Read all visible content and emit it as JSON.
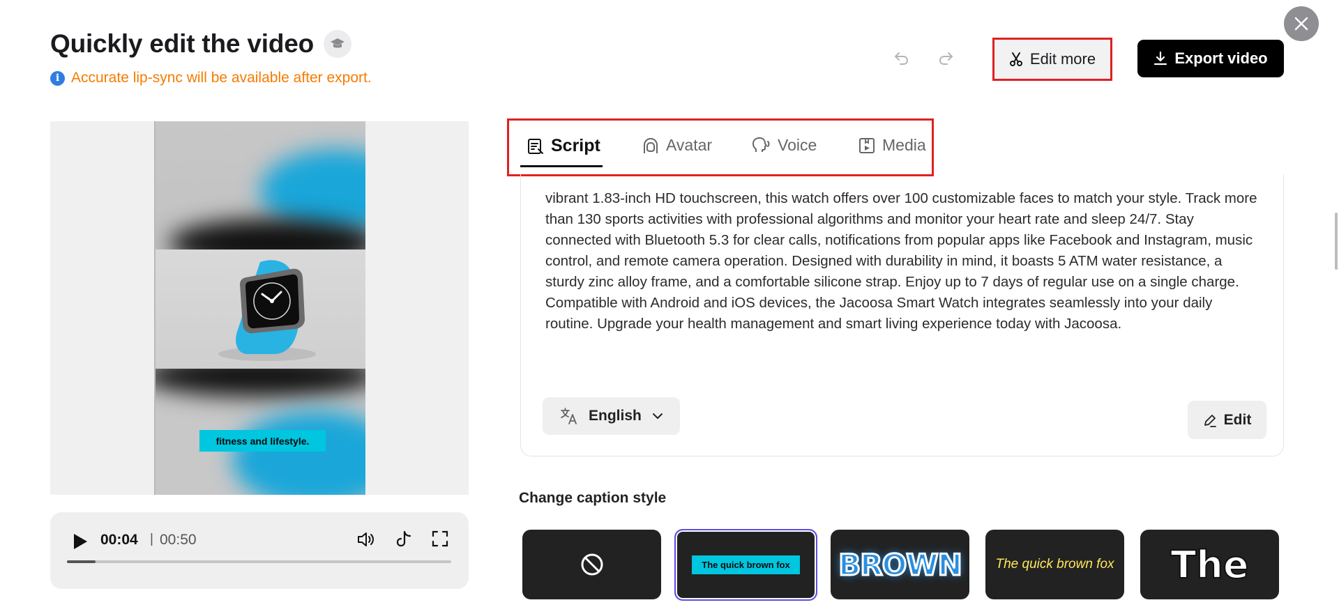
{
  "header": {
    "title": "Quickly edit the video",
    "notice": "Accurate lip-sync will be available after export.",
    "info_icon_text": "i",
    "edit_more_label": "Edit more",
    "export_label": "Export video"
  },
  "preview": {
    "caption_text": "fitness and lifestyle."
  },
  "player": {
    "current_time": "00:04",
    "separator": "|",
    "total_time": "00:50",
    "progress_fraction": 0.075
  },
  "tabs": [
    {
      "label": "Script",
      "active": true
    },
    {
      "label": "Avatar",
      "active": false
    },
    {
      "label": "Voice",
      "active": false
    },
    {
      "label": "Media",
      "active": false
    }
  ],
  "script": {
    "text": "vibrant 1.83-inch HD touchscreen, this watch offers over 100 customizable faces to match your style. Track more than 130 sports activities with professional algorithms and monitor your heart rate and sleep 24/7. Stay connected with Bluetooth 5.3 for clear calls, notifications from popular apps like Facebook and Instagram, music control, and remote camera operation. Designed with durability in mind, it boasts 5 ATM water resistance, a sturdy zinc alloy frame, and a comfortable silicone strap. Enjoy up to 7 days of regular use on a single charge. Compatible with Android and iOS devices, the Jacoosa Smart Watch integrates seamlessly into your daily routine. Upgrade your health management and smart living experience today with Jacoosa.",
    "language": "English",
    "edit_label": "Edit"
  },
  "caption_styles": {
    "title": "Change caption style",
    "items": [
      {
        "kind": "none",
        "text": ""
      },
      {
        "kind": "boxed",
        "text": "The quick brown fox"
      },
      {
        "kind": "brown",
        "text": "BROWN"
      },
      {
        "kind": "yellow",
        "text": "The quick brown fox"
      },
      {
        "kind": "the",
        "text": "The"
      }
    ],
    "selected_index": 1
  },
  "colors": {
    "accent_cyan": "#00c6e0",
    "notice_orange": "#f57c00",
    "highlight_red": "#e02020",
    "selected_purple": "#5c4de6"
  }
}
